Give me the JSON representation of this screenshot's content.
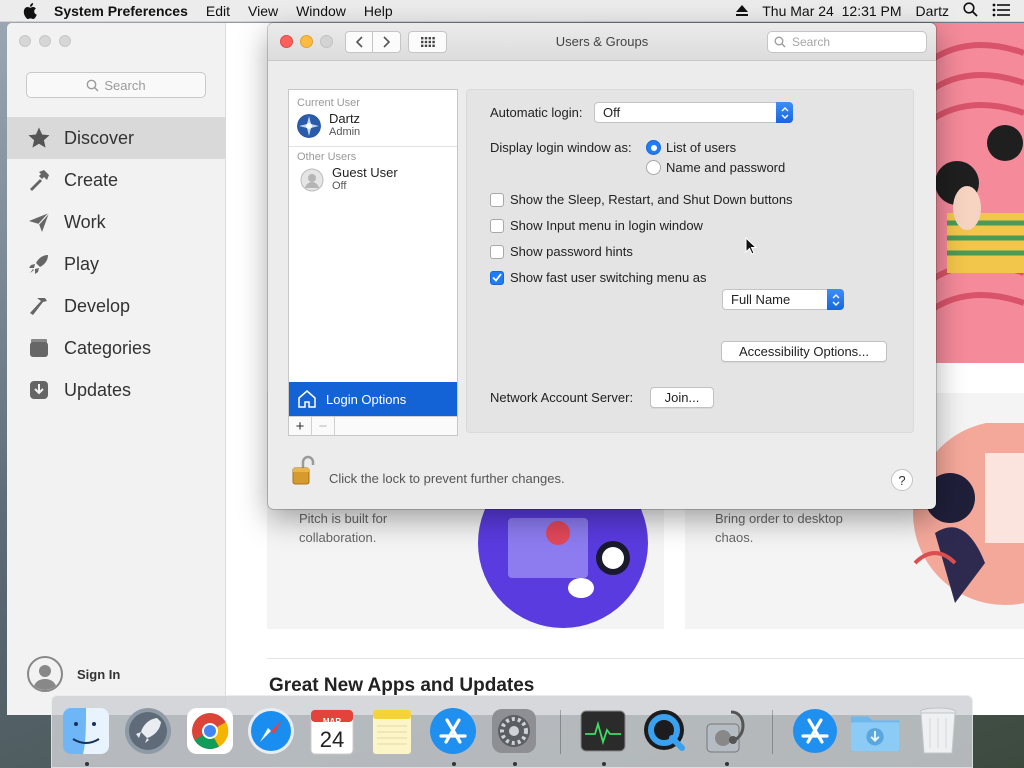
{
  "menubar": {
    "app_name": "System Preferences",
    "menus": [
      "Edit",
      "View",
      "Window",
      "Help"
    ],
    "datetime": "Thu Mar 24  12:31 PM",
    "user": "Dartz"
  },
  "appstore": {
    "search_placeholder": "Search",
    "nav": [
      {
        "label": "Discover",
        "icon": "star-icon"
      },
      {
        "label": "Create",
        "icon": "hammer-brush-icon"
      },
      {
        "label": "Work",
        "icon": "paper-plane-icon"
      },
      {
        "label": "Play",
        "icon": "rocket-icon"
      },
      {
        "label": "Develop",
        "icon": "hammer-icon"
      },
      {
        "label": "Categories",
        "icon": "stack-icon"
      },
      {
        "label": "Updates",
        "icon": "download-tray-icon"
      }
    ],
    "sign_in": "Sign In",
    "card_left_text": "Pitch is built for collaboration.",
    "card_right_text": "Bring order to desktop chaos.",
    "section_heading": "Great New Apps and Updates"
  },
  "prefs": {
    "title": "Users & Groups",
    "search_placeholder": "Search",
    "current_user_header": "Current User",
    "current_user": {
      "name": "Dartz",
      "role": "Admin"
    },
    "other_users_header": "Other Users",
    "other_user": {
      "name": "Guest User",
      "role": "Off"
    },
    "login_options_label": "Login Options",
    "footer_add": "+",
    "footer_remove": "−",
    "automatic_login_label": "Automatic login:",
    "automatic_login_value": "Off",
    "display_login_label": "Display login window as:",
    "radio_list": "List of users",
    "radio_name": "Name and password",
    "radio_selected": "List of users",
    "cb_sleep": "Show the Sleep, Restart, and Shut Down buttons",
    "cb_input_menu": "Show Input menu in login window",
    "cb_password_hints": "Show password hints",
    "cb_fast_switch": "Show fast user switching menu as",
    "checkbox_states": {
      "sleep": false,
      "input_menu": false,
      "password_hints": false,
      "fast_switch": true
    },
    "fast_switch_value": "Full Name",
    "accessibility_button": "Accessibility Options...",
    "network_server_label": "Network Account Server:",
    "join_button": "Join...",
    "lock_text": "Click the lock to prevent further changes.",
    "help_label": "?"
  },
  "dock": {
    "apps": [
      "Finder",
      "Launchpad",
      "Google Chrome",
      "Safari",
      "Calendar",
      "Notes",
      "App Store",
      "System Preferences",
      "Activity Monitor",
      "QuickTime Player",
      "Disk Utility",
      "App Store",
      "Downloads",
      "Trash"
    ],
    "calendar_month": "MAR",
    "calendar_day": "24"
  },
  "colors": {
    "accent": "#1f7bf6",
    "selection": "#1363d6",
    "close": "#fc605c",
    "minimize": "#fdbc40"
  }
}
